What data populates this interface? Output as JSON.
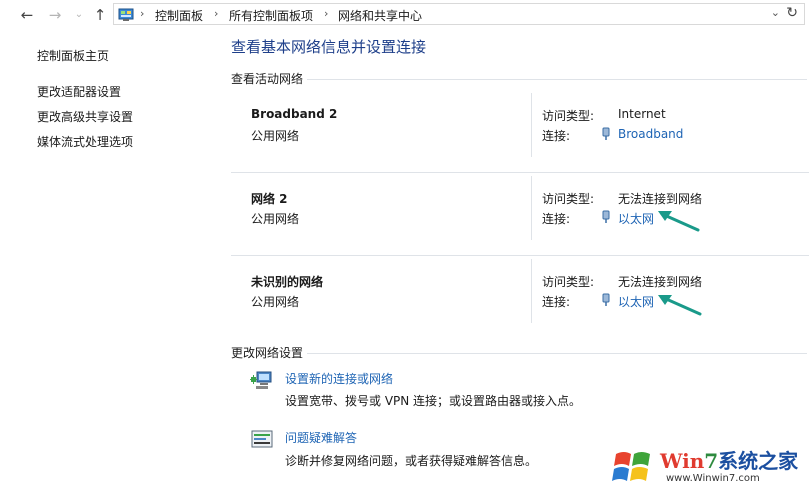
{
  "address_bar": {
    "breadcrumbs": [
      "控制面板",
      "所有控制面板项",
      "网络和共享中心"
    ],
    "back_icon": "arrow-left",
    "forward_icon": "arrow-right",
    "up_icon": "arrow-up",
    "dropdown_icon": "chevron-down",
    "refresh_icon": "refresh"
  },
  "sidebar": {
    "items": [
      {
        "label": "控制面板主页"
      },
      {
        "label": "更改适配器设置"
      },
      {
        "label": "更改高级共享设置"
      },
      {
        "label": "媒体流式处理选项"
      }
    ]
  },
  "main": {
    "title": "查看基本网络信息并设置连接",
    "active_networks_label": "查看活动网络",
    "access_type_label": "访问类型:",
    "connection_label": "连接:",
    "networks": [
      {
        "name": "Broadband 2",
        "category": "公用网络",
        "access_type": "Internet",
        "connection": "Broadband"
      },
      {
        "name": "网络 2",
        "category": "公用网络",
        "access_type": "无法连接到网络",
        "connection": "以太网"
      },
      {
        "name": "未识别的网络",
        "category": "公用网络",
        "access_type": "无法连接到网络",
        "connection": "以太网"
      }
    ],
    "change_settings_label": "更改网络设置",
    "tasks": [
      {
        "title": "设置新的连接或网络",
        "description": "设置宽带、拨号或 VPN 连接；或设置路由器或接入点。"
      },
      {
        "title": "问题疑难解答",
        "description": "诊断并修复网络问题，或者获得疑难解答信息。"
      }
    ]
  },
  "watermark": {
    "brand_part1": "Win",
    "brand_part2": "7",
    "brand_part3": "系统之家",
    "url": "www.Winwin7.com"
  },
  "colors": {
    "title": "#1e3f8a",
    "link": "#1e64b4",
    "annotation_arrow": "#1a9a8a",
    "divider": "#dfe3e8"
  }
}
